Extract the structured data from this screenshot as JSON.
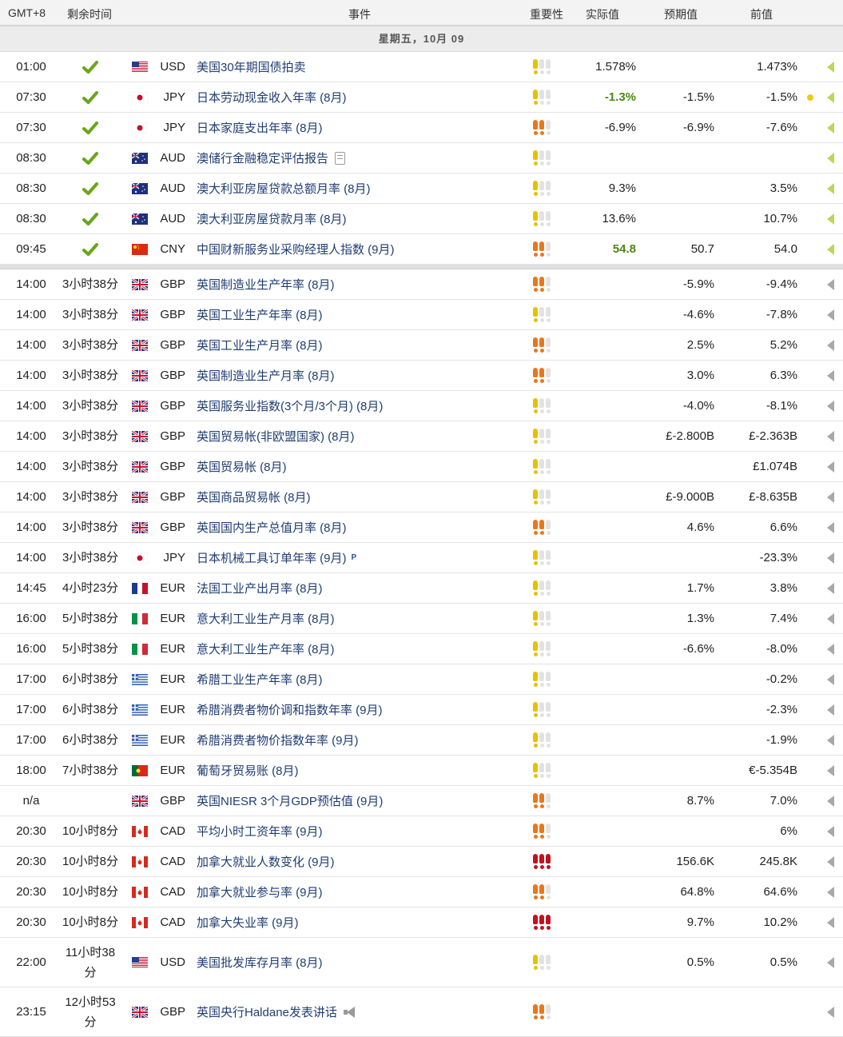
{
  "header": {
    "tz": "GMT+8",
    "remain": "剩余时间",
    "event": "事件",
    "importance": "重要性",
    "actual": "实际值",
    "forecast": "预期值",
    "previous": "前值"
  },
  "day_label": "星期五，10月 09",
  "past_rows": [
    {
      "time": "01:00",
      "flag": "us",
      "cur": "USD",
      "event": "美国30年期国债拍卖",
      "imp": 1,
      "act": "1.578%",
      "fc": "",
      "prev": "1.473%",
      "good": false,
      "dot": false,
      "icon": ""
    },
    {
      "time": "07:30",
      "flag": "jp",
      "cur": "JPY",
      "event": "日本劳动现金收入年率 (8月)",
      "imp": 1,
      "act": "-1.3%",
      "fc": "-1.5%",
      "prev": "-1.5%",
      "good": true,
      "dot": true,
      "icon": ""
    },
    {
      "time": "07:30",
      "flag": "jp",
      "cur": "JPY",
      "event": "日本家庭支出年率 (8月)",
      "imp": 2,
      "act": "-6.9%",
      "fc": "-6.9%",
      "prev": "-7.6%",
      "good": false,
      "dot": false,
      "icon": ""
    },
    {
      "time": "08:30",
      "flag": "au",
      "cur": "AUD",
      "event": "澳储行金融稳定评估报告",
      "imp": 1,
      "act": "",
      "fc": "",
      "prev": "",
      "good": false,
      "dot": false,
      "icon": "doc"
    },
    {
      "time": "08:30",
      "flag": "au",
      "cur": "AUD",
      "event": "澳大利亚房屋贷款总额月率 (8月)",
      "imp": 1,
      "act": "9.3%",
      "fc": "",
      "prev": "3.5%",
      "good": false,
      "dot": false,
      "icon": ""
    },
    {
      "time": "08:30",
      "flag": "au",
      "cur": "AUD",
      "event": "澳大利亚房屋贷款月率 (8月)",
      "imp": 1,
      "act": "13.6%",
      "fc": "",
      "prev": "10.7%",
      "good": false,
      "dot": false,
      "icon": ""
    },
    {
      "time": "09:45",
      "flag": "cn",
      "cur": "CNY",
      "event": "中国财新服务业采购经理人指数 (9月)",
      "imp": 2,
      "act": "54.8",
      "fc": "50.7",
      "prev": "54.0",
      "good": true,
      "dot": false,
      "icon": ""
    }
  ],
  "future_rows": [
    {
      "time": "14:00",
      "remain": "3小时38分",
      "flag": "gb",
      "cur": "GBP",
      "event": "英国制造业生产年率 (8月)",
      "imp": 2,
      "fc": "-5.9%",
      "prev": "-9.4%",
      "icon": ""
    },
    {
      "time": "14:00",
      "remain": "3小时38分",
      "flag": "gb",
      "cur": "GBP",
      "event": "英国工业生产年率 (8月)",
      "imp": 1,
      "fc": "-4.6%",
      "prev": "-7.8%",
      "icon": ""
    },
    {
      "time": "14:00",
      "remain": "3小时38分",
      "flag": "gb",
      "cur": "GBP",
      "event": "英国工业生产月率 (8月)",
      "imp": 2,
      "fc": "2.5%",
      "prev": "5.2%",
      "icon": ""
    },
    {
      "time": "14:00",
      "remain": "3小时38分",
      "flag": "gb",
      "cur": "GBP",
      "event": "英国制造业生产月率 (8月)",
      "imp": 2,
      "fc": "3.0%",
      "prev": "6.3%",
      "icon": ""
    },
    {
      "time": "14:00",
      "remain": "3小时38分",
      "flag": "gb",
      "cur": "GBP",
      "event": "英国服务业指数(3个月/3个月) (8月)",
      "imp": 1,
      "fc": "-4.0%",
      "prev": "-8.1%",
      "icon": ""
    },
    {
      "time": "14:00",
      "remain": "3小时38分",
      "flag": "gb",
      "cur": "GBP",
      "event": "英国贸易帐(非欧盟国家) (8月)",
      "imp": 1,
      "fc": "£-2.800B",
      "prev": "£-2.363B",
      "icon": ""
    },
    {
      "time": "14:00",
      "remain": "3小时38分",
      "flag": "gb",
      "cur": "GBP",
      "event": "英国贸易帐 (8月)",
      "imp": 1,
      "fc": "",
      "prev": "£1.074B",
      "icon": ""
    },
    {
      "time": "14:00",
      "remain": "3小时38分",
      "flag": "gb",
      "cur": "GBP",
      "event": "英国商品贸易帐 (8月)",
      "imp": 1,
      "fc": "£-9.000B",
      "prev": "£-8.635B",
      "icon": ""
    },
    {
      "time": "14:00",
      "remain": "3小时38分",
      "flag": "gb",
      "cur": "GBP",
      "event": "英国国内生产总值月率 (8月)",
      "imp": 2,
      "fc": "4.6%",
      "prev": "6.6%",
      "icon": ""
    },
    {
      "time": "14:00",
      "remain": "3小时38分",
      "flag": "jp",
      "cur": "JPY",
      "event": "日本机械工具订单年率 (9月)",
      "imp": 1,
      "fc": "",
      "prev": "-23.3%",
      "icon": "p"
    },
    {
      "time": "14:45",
      "remain": "4小时23分",
      "flag": "fr",
      "cur": "EUR",
      "event": "法国工业产出月率 (8月)",
      "imp": 1,
      "fc": "1.7%",
      "prev": "3.8%",
      "icon": ""
    },
    {
      "time": "16:00",
      "remain": "5小时38分",
      "flag": "it",
      "cur": "EUR",
      "event": "意大利工业生产月率 (8月)",
      "imp": 1,
      "fc": "1.3%",
      "prev": "7.4%",
      "icon": ""
    },
    {
      "time": "16:00",
      "remain": "5小时38分",
      "flag": "it",
      "cur": "EUR",
      "event": "意大利工业生产年率 (8月)",
      "imp": 1,
      "fc": "-6.6%",
      "prev": "-8.0%",
      "icon": ""
    },
    {
      "time": "17:00",
      "remain": "6小时38分",
      "flag": "gr",
      "cur": "EUR",
      "event": "希腊工业生产年率 (8月)",
      "imp": 1,
      "fc": "",
      "prev": "-0.2%",
      "icon": ""
    },
    {
      "time": "17:00",
      "remain": "6小时38分",
      "flag": "gr",
      "cur": "EUR",
      "event": "希腊消费者物价调和指数年率 (9月)",
      "imp": 1,
      "fc": "",
      "prev": "-2.3%",
      "icon": ""
    },
    {
      "time": "17:00",
      "remain": "6小时38分",
      "flag": "gr",
      "cur": "EUR",
      "event": "希腊消费者物价指数年率 (9月)",
      "imp": 1,
      "fc": "",
      "prev": "-1.9%",
      "icon": ""
    },
    {
      "time": "18:00",
      "remain": "7小时38分",
      "flag": "pt",
      "cur": "EUR",
      "event": "葡萄牙贸易账 (8月)",
      "imp": 1,
      "fc": "",
      "prev": "€-5.354B",
      "icon": ""
    },
    {
      "time": "n/a",
      "remain": "",
      "flag": "gb",
      "cur": "GBP",
      "event": "英国NIESR 3个月GDP预估值 (9月)",
      "imp": 2,
      "fc": "8.7%",
      "prev": "7.0%",
      "icon": ""
    },
    {
      "time": "20:30",
      "remain": "10小时8分",
      "flag": "ca",
      "cur": "CAD",
      "event": "平均小时工资年率 (9月)",
      "imp": 2,
      "fc": "",
      "prev": "6%",
      "icon": ""
    },
    {
      "time": "20:30",
      "remain": "10小时8分",
      "flag": "ca",
      "cur": "CAD",
      "event": "加拿大就业人数变化 (9月)",
      "imp": 3,
      "fc": "156.6K",
      "prev": "245.8K",
      "icon": ""
    },
    {
      "time": "20:30",
      "remain": "10小时8分",
      "flag": "ca",
      "cur": "CAD",
      "event": "加拿大就业参与率 (9月)",
      "imp": 2,
      "fc": "64.8%",
      "prev": "64.6%",
      "icon": ""
    },
    {
      "time": "20:30",
      "remain": "10小时8分",
      "flag": "ca",
      "cur": "CAD",
      "event": "加拿大失业率 (9月)",
      "imp": 3,
      "fc": "9.7%",
      "prev": "10.2%",
      "icon": ""
    },
    {
      "time": "22:00",
      "remain": "11小时38分",
      "flag": "us",
      "cur": "USD",
      "event": "美国批发库存月率 (8月)",
      "imp": 1,
      "fc": "0.5%",
      "prev": "0.5%",
      "icon": "",
      "tall": true
    },
    {
      "time": "23:15",
      "remain": "12小时53分",
      "flag": "gb",
      "cur": "GBP",
      "event": "英国央行Haldane发表讲话",
      "imp": 2,
      "fc": "",
      "prev": "",
      "icon": "speaker",
      "tall": true
    }
  ],
  "colors": {
    "imp1": "#e6c100",
    "imp2": "#e8771c",
    "imp3": "#c1121f",
    "empty": "#e2e2e2",
    "good": "#4a8a12",
    "check": "#6aa61a",
    "event_text": "#1f3d73"
  }
}
